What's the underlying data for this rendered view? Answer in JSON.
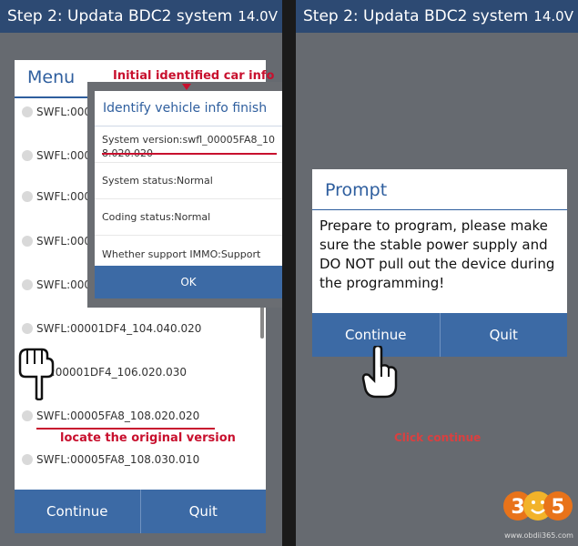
{
  "left_screen": {
    "header": {
      "title": "Step 2: Updata BDC2 system",
      "voltage": "14.0V"
    },
    "menu": {
      "title": "Menu",
      "items": [
        "SWFL:0000",
        "SWFL:0000",
        "SWFL:0000",
        "SWFL:0000",
        "SWFL:0000",
        "SWFL:00001DF4_104.040.020",
        "L:00001DF4_106.020.030",
        "SWFL:00005FA8_108.020.020",
        "SWFL:00005FA8_108.030.010"
      ],
      "continue_label": "Continue",
      "quit_label": "Quit"
    },
    "identify_dialog": {
      "title": "Identify vehicle info finish",
      "system_version": "System version:swfl_00005FA8_108.020.020",
      "system_status": "System status:Normal",
      "coding_status": "Coding status:Normal",
      "immo_support": "Whether support IMMO:Support",
      "ok_label": "OK"
    },
    "annotations": {
      "initial_info": "Initial identified car info",
      "locate_version": "locate the original version"
    }
  },
  "right_screen": {
    "header": {
      "title": "Step 2: Updata BDC2 system",
      "voltage": "14.0V"
    },
    "prompt": {
      "title": "Prompt",
      "message": "Prepare to program, please make sure the stable power supply and DO NOT pull out the device during the programming!",
      "continue_label": "Continue",
      "quit_label": "Quit"
    },
    "annotations": {
      "click_continue": "Click continue"
    },
    "logo": {
      "number": "365",
      "url": "www.obdii365.com"
    }
  },
  "colors": {
    "header_bg": "#2d4a73",
    "accent_blue": "#3c6aa5",
    "title_blue": "#2e5e9e",
    "annotation_red": "#c8102e",
    "backdrop": "#666a70"
  },
  "icons": [
    "wifi-icon",
    "radio-icon",
    "pointing-hand-icon",
    "logo-icon"
  ]
}
